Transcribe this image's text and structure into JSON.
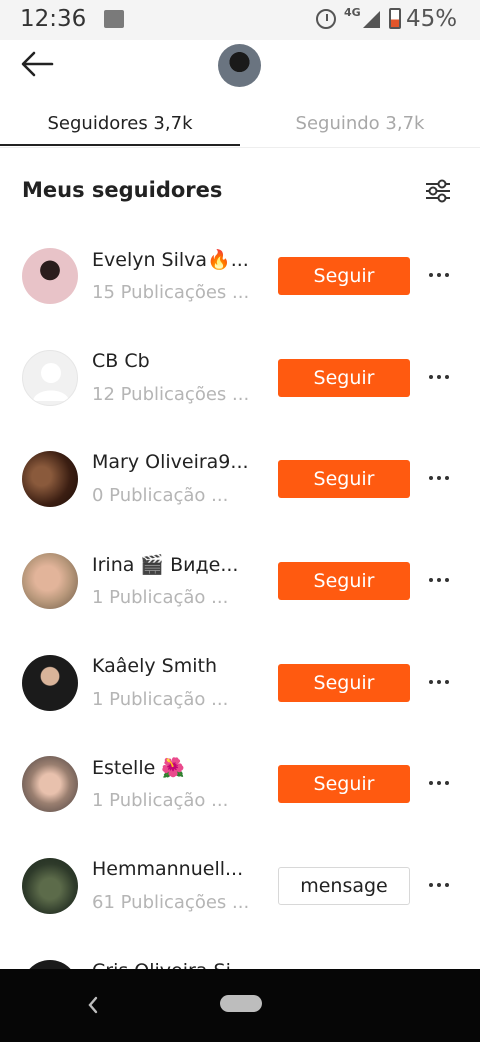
{
  "status_bar": {
    "time": "12:36",
    "network": "4G",
    "battery": "45%"
  },
  "tabs": [
    {
      "label": "Seguidores 3,7k",
      "active": true
    },
    {
      "label": "Seguindo 3,7k",
      "active": false
    }
  ],
  "section": {
    "title": "Meus seguidores"
  },
  "followers": [
    {
      "name": "Evelyn Silva🔥...",
      "posts": "15 Publicações ...",
      "button": "Seguir"
    },
    {
      "name": "CB Cb",
      "posts": "12 Publicações ...",
      "button": "Seguir"
    },
    {
      "name": "Mary Oliveira9...",
      "posts": "0 Publicação ...",
      "button": "Seguir"
    },
    {
      "name": "Irina 🎬 Виде...",
      "posts": "1 Publicação ...",
      "button": "Seguir"
    },
    {
      "name": "Kaâely Smith",
      "posts": "1 Publicação ...",
      "button": "Seguir"
    },
    {
      "name": "Estelle 🌺",
      "posts": "1 Publicação ...",
      "button": "Seguir"
    },
    {
      "name": "Hemmannuell...",
      "posts": "61 Publicações ...",
      "button": "mensage"
    },
    {
      "name": "Cris Oliveira Si"
    }
  ],
  "colors": {
    "follow_button": "#ff5a10",
    "nav_bar": "#060606"
  }
}
